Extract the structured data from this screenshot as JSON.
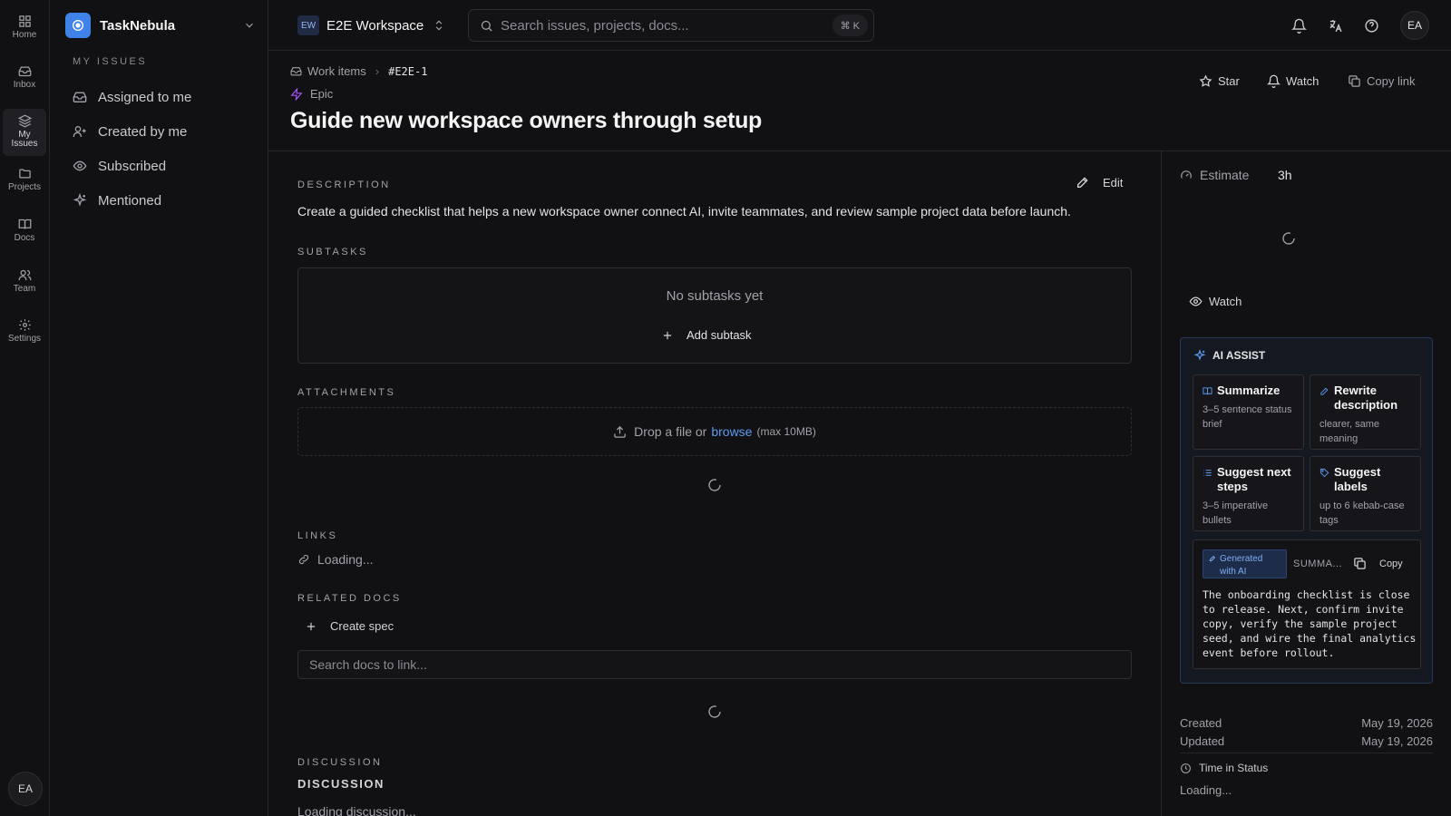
{
  "rail": {
    "items": [
      {
        "label": "Home",
        "icon": "grid-icon"
      },
      {
        "label": "Inbox",
        "icon": "inbox-icon"
      },
      {
        "label": "My Issues",
        "icon": "layers-icon"
      },
      {
        "label": "Projects",
        "icon": "folder-icon"
      },
      {
        "label": "Docs",
        "icon": "book-icon"
      },
      {
        "label": "Team",
        "icon": "users-icon"
      },
      {
        "label": "Settings",
        "icon": "gear-icon"
      }
    ],
    "avatar": "EA"
  },
  "sidebar": {
    "brand": "TaskNebula",
    "section_title": "MY ISSUES",
    "items": [
      {
        "label": "Assigned to me",
        "icon": "inbox-icon"
      },
      {
        "label": "Created by me",
        "icon": "user-plus-icon"
      },
      {
        "label": "Subscribed",
        "icon": "eye-icon"
      },
      {
        "label": "Mentioned",
        "icon": "sparkle-icon"
      }
    ]
  },
  "topbar": {
    "workspace_badge": "EW",
    "workspace_name": "E2E Workspace",
    "search_placeholder": "Search issues, projects, docs...",
    "shortcut": "⌘ K",
    "avatar": "EA"
  },
  "header": {
    "breadcrumb_root": "Work items",
    "breadcrumb_current": "#E2E-1",
    "type": "Epic",
    "title": "Guide new workspace owners through setup",
    "star": "Star",
    "watch": "Watch",
    "copy_link": "Copy link"
  },
  "main": {
    "description_label": "DESCRIPTION",
    "edit": "Edit",
    "description": "Create a guided checklist that helps a new workspace owner connect AI, invite teammates, and review sample project data before launch.",
    "subtasks_label": "SUBTASKS",
    "no_subtasks": "No subtasks yet",
    "add_subtask": "Add subtask",
    "attachments_label": "ATTACHMENTS",
    "drop_text": "Drop a file or",
    "browse": "browse",
    "max_size": "(max 10MB)",
    "links_label": "LINKS",
    "links_loading": "Loading...",
    "related_docs_label": "RELATED DOCS",
    "create_spec": "Create spec",
    "doc_search_placeholder": "Search docs to link...",
    "discussion_label": "DISCUSSION",
    "discussion_heading": "DISCUSSION",
    "discussion_loading": "Loading discussion..."
  },
  "panel": {
    "estimate_label": "Estimate",
    "estimate_value": "3h",
    "watch": "Watch",
    "ai": {
      "title": "AI ASSIST",
      "actions": [
        {
          "title": "Summarize",
          "desc": "3–5 sentence status brief",
          "icon": "book-open-icon"
        },
        {
          "title": "Rewrite description",
          "desc": "clearer, same meaning",
          "icon": "pencil-icon"
        },
        {
          "title": "Suggest next steps",
          "desc": "3–5 imperative bullets",
          "icon": "list-icon"
        },
        {
          "title": "Suggest labels",
          "desc": "up to 6 kebab-case tags",
          "icon": "tag-icon"
        }
      ],
      "generated_badge": "Generated with AI",
      "result_mode": "SUMMA...",
      "copy": "Copy",
      "result_text": "The onboarding checklist is close to release. Next, confirm invite copy, verify the sample project seed, and wire the final analytics event before rollout."
    },
    "created_label": "Created",
    "created_value": "May 19, 2026",
    "updated_label": "Updated",
    "updated_value": "May 19, 2026",
    "time_in_status": "Time in Status",
    "time_loading": "Loading..."
  }
}
